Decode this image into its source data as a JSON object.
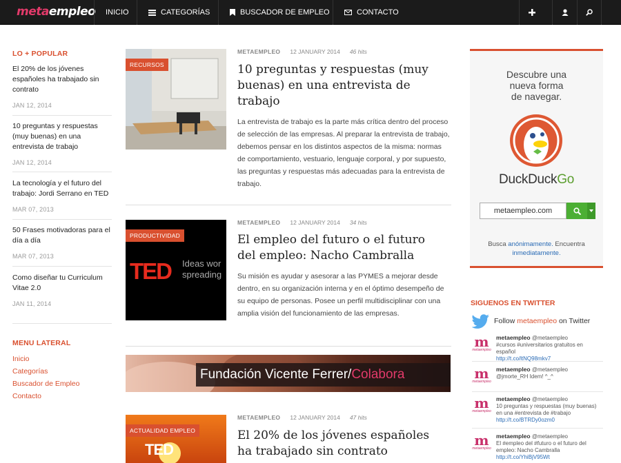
{
  "nav": {
    "logo_a": "meta",
    "logo_b": "empleo",
    "items": [
      "INICIO",
      "CATEGORÍAS",
      "BUSCADOR DE EMPLEO",
      "CONTACTO"
    ]
  },
  "popular": {
    "title": "LO + POPULAR",
    "items": [
      {
        "title": "El 20% de los jóvenes españoles ha trabajado sin contrato",
        "date": "JAN 12, 2014"
      },
      {
        "title": "10 preguntas y respuestas (muy buenas) en una entrevista de trabajo",
        "date": "JAN 12, 2014"
      },
      {
        "title": "La tecnología y el futuro del trabajo: Jordi Serrano en TED",
        "date": "MAR 07, 2013"
      },
      {
        "title": "50 Frases motivadoras para el día a día",
        "date": "MAR 07, 2013"
      },
      {
        "title": "Como diseñar tu Curriculum Vitae 2.0",
        "date": "JAN 11, 2014"
      }
    ]
  },
  "menu": {
    "title": "MENU LATERAL",
    "links": [
      "Inicio",
      "Categorías",
      "Buscador de Empleo",
      "Contacto"
    ]
  },
  "articles": [
    {
      "category": "RECURSOS",
      "author": "METAEMPLEO",
      "date": "12 JANUARY 2014",
      "hits": "46 hits",
      "title": "10 preguntas y respuestas (muy buenas) en una entrevista de trabajo",
      "body": "La entrevista de trabajo es la parte más crítica dentro del proceso de selección de las empresas. Al preparar la entrevista de trabajo, debemos pensar en los distintos aspectos de la misma: normas de comportamiento, vestuario, lenguaje corporal, y por supuesto, las preguntas y respuestas más adecuadas para la entrevista de trabajo."
    },
    {
      "category": "PRODUCTIVIDAD",
      "author": "METAEMPLEO",
      "date": "12 JANUARY 2014",
      "hits": "34 hits",
      "title": "El empleo del futuro o el futuro del empleo: Nacho Cambralla",
      "body": "Su misión es ayudar y asesorar a las PYMES a mejorar desde dentro, en su organización interna y en el óptimo desempeño de su equipo de personas. Posee un perfil multidisciplinar con una amplia visión del funcionamiento de las empresas.",
      "thumb_ted": "TED",
      "thumb_text": "Ideas wor spreading"
    },
    {
      "category": "ACTUALIDAD EMPLEO",
      "author": "METAEMPLEO",
      "date": "12 JANUARY 2014",
      "hits": "47 hits",
      "title": "El 20% de los jóvenes españoles ha trabajado sin contrato",
      "thumb_ted": "TED"
    }
  ],
  "banner": {
    "text_a": "Fundación Vicente Ferrer/",
    "text_b": "Colabora"
  },
  "ddg": {
    "tagline": [
      "Descubre una",
      "nueva forma",
      "de navegar."
    ],
    "name_a": "DuckDuck",
    "name_b": "Go",
    "search_value": "metaempleo.com",
    "sub_a": "Busca ",
    "sub_link1": "anónimamente.",
    "sub_b": " Encuentra",
    "sub_link2": "inmediatamente."
  },
  "twitter": {
    "title": "SIGUENOS EN TWITTER",
    "follow_a": "Follow ",
    "follow_handle": "metaempleo",
    "follow_b": " on Twitter",
    "avatar_text": "m",
    "avatar_word": "metaempleo",
    "tweets": [
      {
        "user": "metaempleo",
        "handle": "@metaempleo",
        "text": "#cursos #universitarios gratuitos en español",
        "link": "http://t.co/ltNQ98mkv7"
      },
      {
        "user": "metaempleo",
        "handle": "@metaempleo",
        "text": "@jmorte_RH Idem! ^_^",
        "link": ""
      },
      {
        "user": "metaempleo",
        "handle": "@metaempleo",
        "text": "10 preguntas y respuestas (muy buenas) en una #entrevista de #trabajo",
        "link": "http://t.co/BTRDy0ozm0"
      },
      {
        "user": "metaempleo",
        "handle": "@metaempleo",
        "text": "El #empleo del #futuro o el futuro del empleo: Nacho Cambralla",
        "link": "http://t.co/YhiBjV95Wt"
      }
    ]
  },
  "colors": {
    "accent": "#d9502f",
    "nav_bg": "#1b1b1b",
    "logo_pink": "#e23a6a",
    "ddg_green": "#4caf34"
  }
}
